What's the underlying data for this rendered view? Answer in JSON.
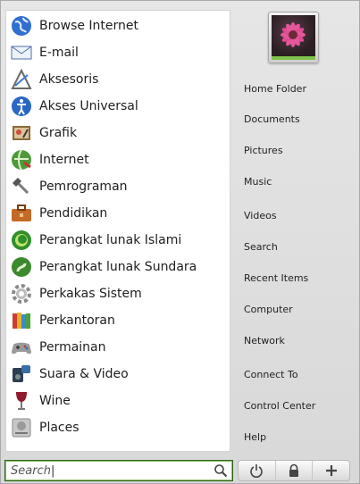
{
  "menu": {
    "categories": [
      {
        "label": "Browse Internet",
        "icon": "globe-icon"
      },
      {
        "label": "E-mail",
        "icon": "envelope-icon"
      },
      {
        "label": "Aksesoris",
        "icon": "accessories-icon"
      },
      {
        "label": "Akses Universal",
        "icon": "accessibility-icon"
      },
      {
        "label": "Grafik",
        "icon": "graphics-icon"
      },
      {
        "label": "Internet",
        "icon": "internet-icon"
      },
      {
        "label": "Pemrograman",
        "icon": "hammer-icon"
      },
      {
        "label": "Pendidikan",
        "icon": "toolbox-icon"
      },
      {
        "label": "Perangkat lunak Islami",
        "icon": "islamic-software-icon"
      },
      {
        "label": "Perangkat lunak Sundara",
        "icon": "sundanese-software-icon"
      },
      {
        "label": "Perkakas Sistem",
        "icon": "gear-icon"
      },
      {
        "label": "Perkantoran",
        "icon": "books-icon"
      },
      {
        "label": "Permainan",
        "icon": "gamepad-icon"
      },
      {
        "label": "Suara & Video",
        "icon": "speaker-icon"
      },
      {
        "label": "Wine",
        "icon": "wine-glass-icon"
      },
      {
        "label": "Places",
        "icon": "hard-drive-icon"
      }
    ]
  },
  "places": {
    "items": [
      "Home Folder",
      "Documents",
      "Pictures",
      "Music",
      "Videos",
      "Search",
      "Recent Items",
      "Computer",
      "Network",
      "Connect To",
      "Control Center",
      "Help"
    ]
  },
  "search": {
    "placeholder": "Search"
  },
  "colors": {
    "accent": "#8bc262",
    "panel": "#ffffff",
    "background": "#e0e0e0"
  }
}
